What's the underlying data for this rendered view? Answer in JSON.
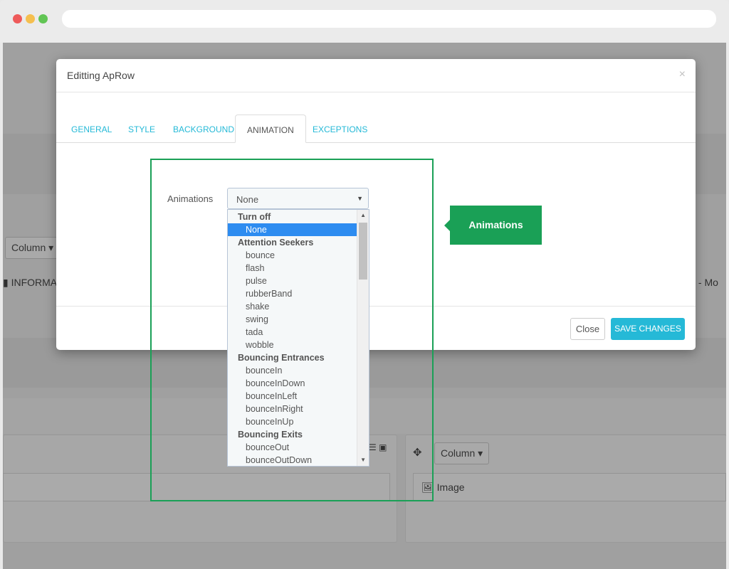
{
  "background": {
    "column_label": "Column",
    "column_label_2": "Column",
    "info_text": "INFORMAT",
    "right_text": "s - Mo",
    "image_label": "Image"
  },
  "modal": {
    "title": "Editting ApRow",
    "close_glyph": "×",
    "tabs": [
      {
        "label": "GENERAL"
      },
      {
        "label": "STYLE"
      },
      {
        "label": "BACKGROUND"
      },
      {
        "label": "ANIMATION"
      },
      {
        "label": "EXCEPTIONS"
      }
    ],
    "active_tab": "ANIMATION",
    "field_label": "Animations",
    "select_value": "None",
    "footer": {
      "close_label": "Close",
      "save_label": "SAVE CHANGES"
    }
  },
  "dropdown": {
    "rows": [
      {
        "label": "Turn off",
        "group": true
      },
      {
        "label": "None",
        "selected": true
      },
      {
        "label": "Attention Seekers",
        "group": true
      },
      {
        "label": "bounce"
      },
      {
        "label": "flash"
      },
      {
        "label": "pulse"
      },
      {
        "label": "rubberBand"
      },
      {
        "label": "shake"
      },
      {
        "label": "swing"
      },
      {
        "label": "tada"
      },
      {
        "label": "wobble"
      },
      {
        "label": "Bouncing Entrances",
        "group": true
      },
      {
        "label": "bounceIn"
      },
      {
        "label": "bounceInDown"
      },
      {
        "label": "bounceInLeft"
      },
      {
        "label": "bounceInRight"
      },
      {
        "label": "bounceInUp"
      },
      {
        "label": "Bouncing Exits",
        "group": true
      },
      {
        "label": "bounceOut"
      },
      {
        "label": "bounceOutDown"
      }
    ]
  },
  "annotation": {
    "callout_label": "Animations"
  },
  "colors": {
    "accent": "#25b9d7",
    "highlight": "#1aa056",
    "selected": "#2d8cf0"
  },
  "icons": [
    "close-icon",
    "caret-down-icon",
    "move-icon",
    "image-icon",
    "plus-icon",
    "list-icon"
  ]
}
